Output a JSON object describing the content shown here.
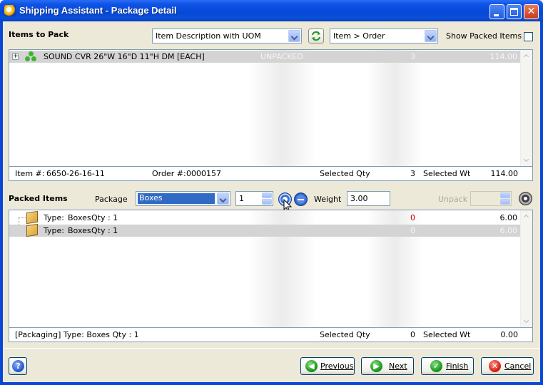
{
  "window": {
    "title": "Shipping Assistant - Package Detail"
  },
  "items_to_pack": {
    "heading": "Items to Pack",
    "view_combo": "Item Description with UOM",
    "sort_combo": "Item > Order",
    "show_packed_label": "Show Packed Items",
    "rows": [
      {
        "description": "SOUND CVR 26\"W 16\"D 11\"H DM [EACH]",
        "status": "UNPACKED",
        "qty": "3",
        "weight": "114.00"
      }
    ],
    "footer": {
      "item_label": "Item #:",
      "item_value": "6650-26-16-11",
      "order_label": "Order #:",
      "order_value": "0000157",
      "sel_qty_label": "Selected Qty",
      "sel_qty_value": "3",
      "sel_wt_label": "Selected Wt",
      "sel_wt_value": "114.00"
    }
  },
  "packed_items": {
    "heading": "Packed Items",
    "package_label": "Package",
    "package_value": "Boxes",
    "count_value": "1",
    "weight_label": "Weight",
    "weight_value": "3.00",
    "unpack_label": "Unpack",
    "rows": [
      {
        "type_label": "Type:",
        "type_value": "Boxes",
        "qty_text": "Qty : 1",
        "count": "0",
        "weight": "6.00"
      },
      {
        "type_label": "Type:",
        "type_value": "Boxes",
        "qty_text": "Qty : 1",
        "count": "0",
        "weight": "6.00"
      }
    ],
    "footer": {
      "summary": "[Packaging] Type:  Boxes  Qty : 1",
      "sel_qty_label": "Selected Qty",
      "sel_qty_value": "0",
      "sel_wt_label": "Selected Wt",
      "sel_wt_value": "0.00"
    }
  },
  "buttons": {
    "previous": "Previous",
    "next": "Next",
    "finish": "Finish",
    "cancel": "Cancel"
  },
  "colors": {
    "title_bar": "#0a46d8",
    "selection_highlight": "#d4d4d4",
    "package_select_blue": "#316ac5",
    "red_count": "#cc0000"
  }
}
